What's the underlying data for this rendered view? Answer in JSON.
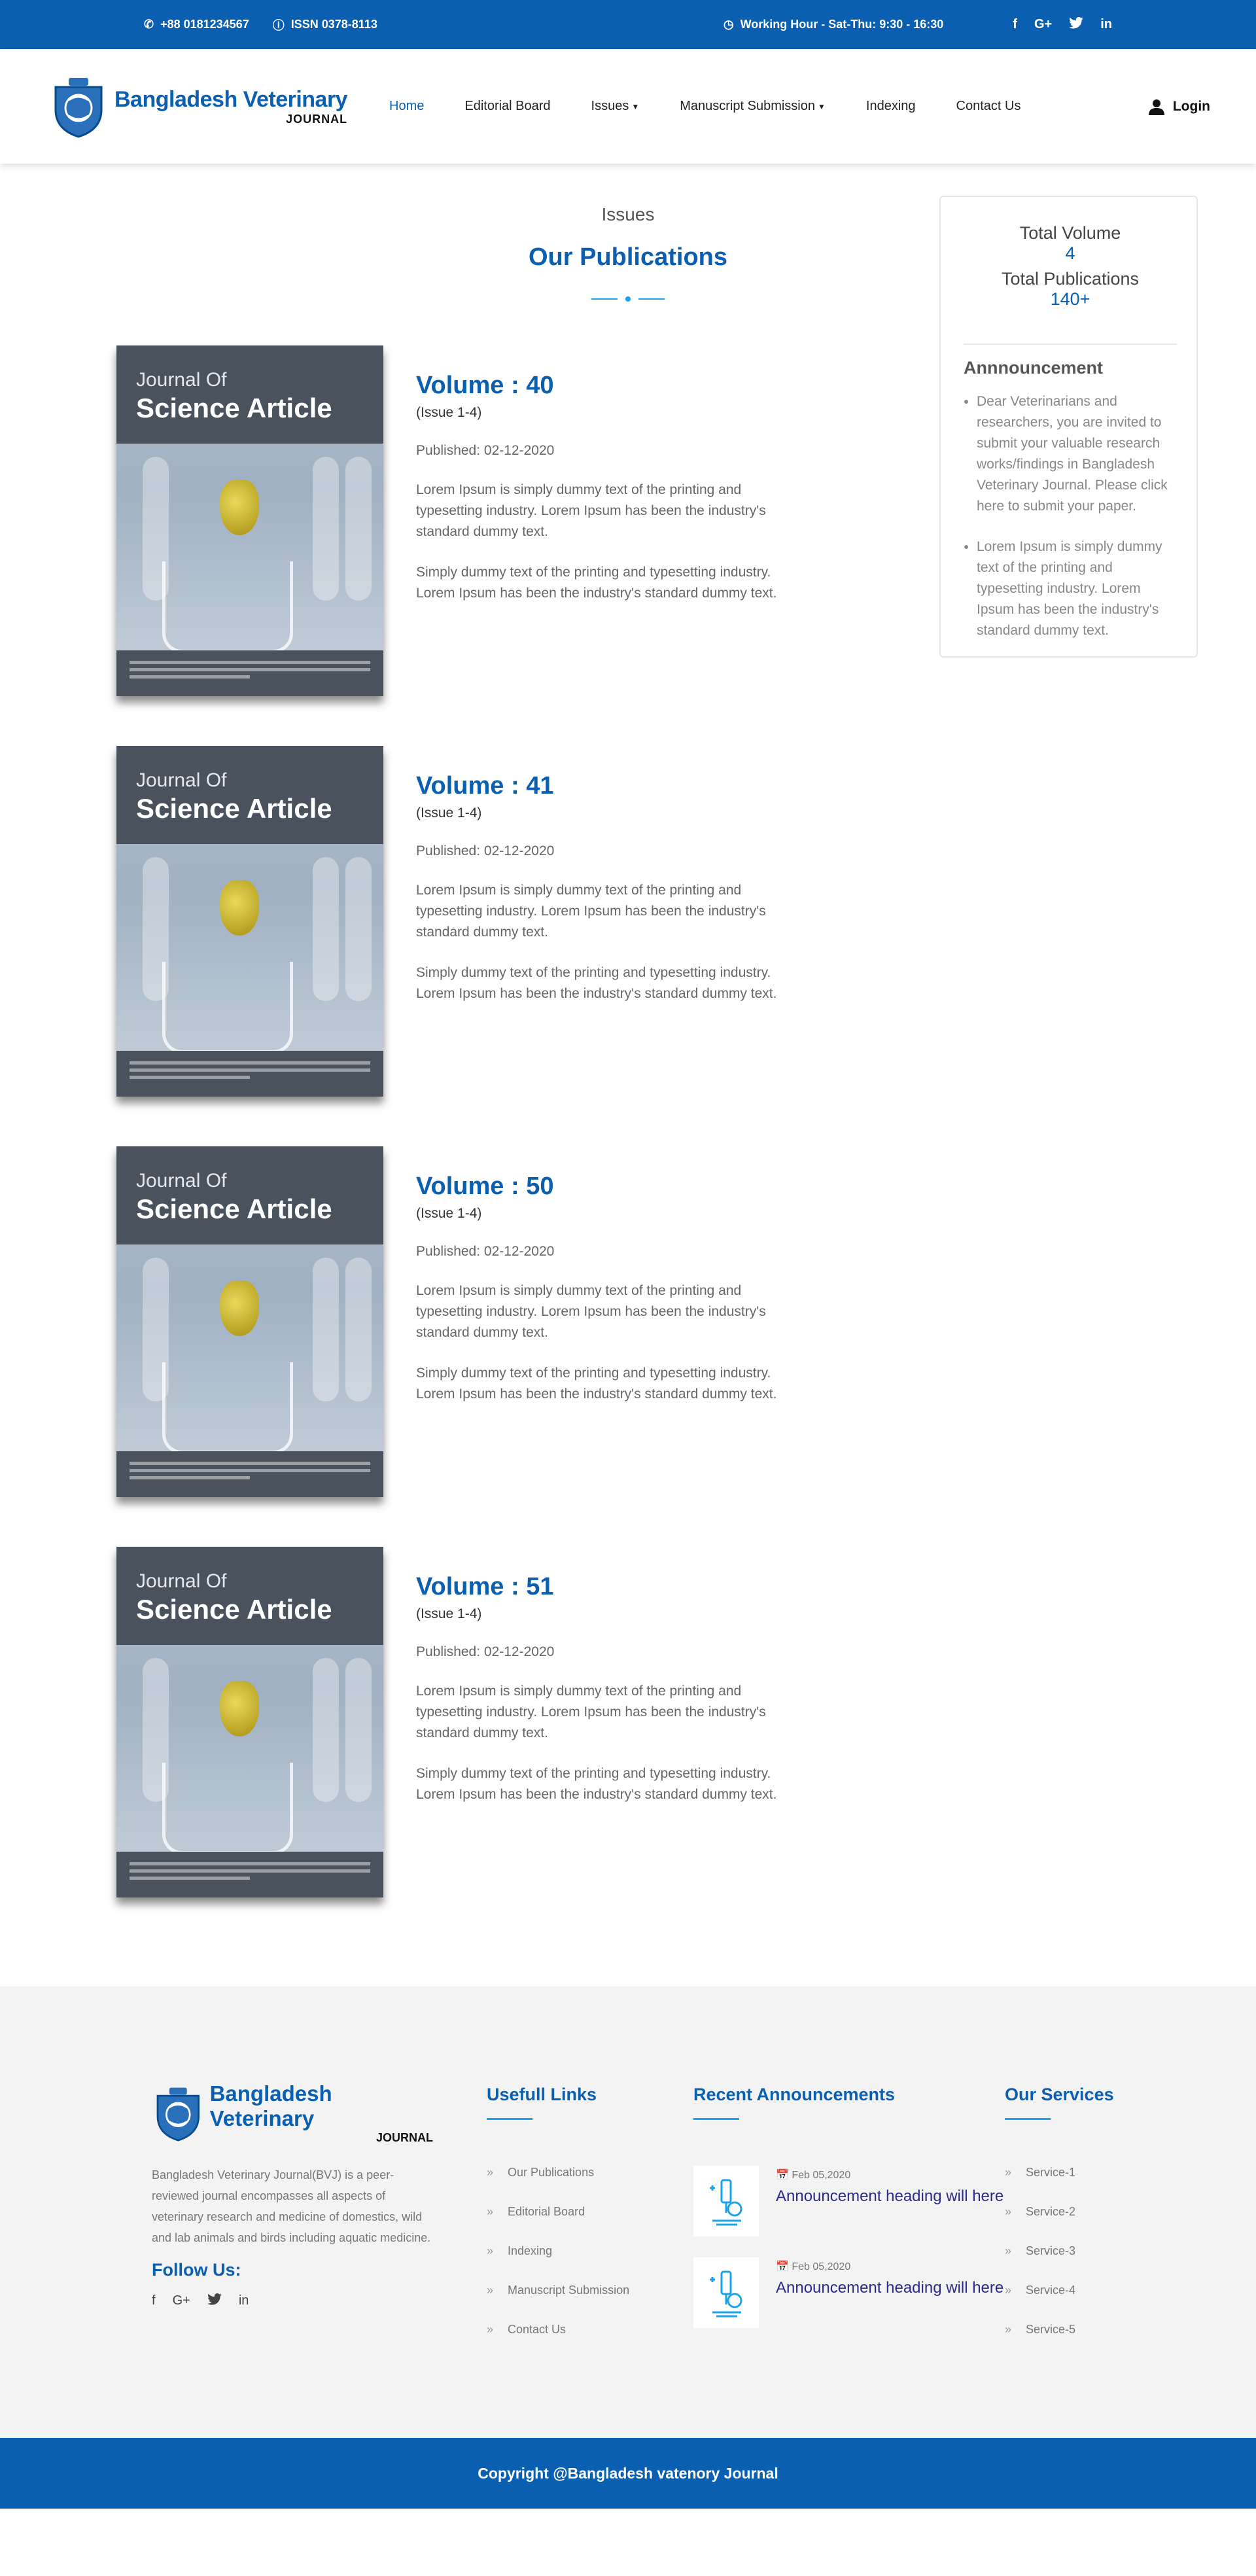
{
  "topbar": {
    "phone": "+88 0181234567",
    "issn": "ISSN 0378-8113",
    "hours": "Working Hour - Sat-Thu: 9:30 - 16:30",
    "social": [
      "f",
      "G+",
      "twitter",
      "in"
    ]
  },
  "header": {
    "brand_name": "Bangladesh Veterinary",
    "brand_sub": "JOURNAL",
    "nav": [
      {
        "label": "Home"
      },
      {
        "label": "Editorial Board"
      },
      {
        "label": "Issues"
      },
      {
        "label": "Manuscript Submission"
      },
      {
        "label": "Indexing"
      },
      {
        "label": "Contact Us"
      }
    ],
    "login": "Login"
  },
  "section": {
    "eyebrow": "Issues",
    "title": "Our Publications"
  },
  "cover": {
    "line1": "Journal Of",
    "line2": "Science Article"
  },
  "volumes": [
    {
      "title": "Volume : 40",
      "issue": "(Issue 1-4)",
      "published": "Published: 02-12-2020",
      "p1": "Lorem Ipsum is simply dummy text of the printing and typesetting industry. Lorem Ipsum has been the industry's standard dummy text.",
      "p2": "Simply dummy text of the printing and typesetting industry. Lorem Ipsum has been the industry's standard dummy text."
    },
    {
      "title": "Volume : 41",
      "issue": "(Issue 1-4)",
      "published": "Published: 02-12-2020",
      "p1": "Lorem Ipsum is simply dummy text of the printing and typesetting industry. Lorem Ipsum has been the industry's standard dummy text.",
      "p2": "Simply dummy text of the printing and typesetting industry. Lorem Ipsum has been the industry's standard dummy text."
    },
    {
      "title": "Volume : 50",
      "issue": "(Issue 1-4)",
      "published": "Published: 02-12-2020",
      "p1": "Lorem Ipsum is simply dummy text of the printing and typesetting industry. Lorem Ipsum has been the industry's standard dummy text.",
      "p2": "Simply dummy text of the printing and typesetting industry. Lorem Ipsum has been the industry's standard dummy text."
    },
    {
      "title": "Volume : 51",
      "issue": "(Issue 1-4)",
      "published": "Published: 02-12-2020",
      "p1": "Lorem Ipsum is simply dummy text of the printing and typesetting industry. Lorem Ipsum has been the industry's standard dummy text.",
      "p2": "Simply dummy text of the printing and typesetting industry. Lorem Ipsum has been the industry's standard dummy text."
    }
  ],
  "sidebar": {
    "total_volume_label": "Total Volume",
    "total_volume_value": "4",
    "total_pubs_label": "Total Publications",
    "total_pubs_value": "140+",
    "announcement_title": "Annnouncement",
    "announcements": [
      "Dear Veterinarians and researchers, you are invited to submit your valuable research works/findings in Bangladesh Veterinary Journal. Please click here to submit your paper.",
      "Lorem Ipsum is simply dummy text of the printing and typesetting industry. Lorem Ipsum has been the industry's standard dummy text."
    ]
  },
  "footer": {
    "brand_name": "Bangladesh Veterinary",
    "brand_sub": "JOURNAL",
    "description": "Bangladesh Veterinary Journal(BVJ) is a peer-reviewed journal encompasses all aspects of veterinary research and medicine of domestics, wild and lab animals and birds including aquatic medicine.",
    "follow_us": "Follow Us:",
    "links_title": "Usefull Links",
    "links": [
      "Our Publications",
      "Editorial Board",
      "Indexing",
      "Manuscript Submission",
      "Contact Us"
    ],
    "recent_title": "Recent Announcements",
    "recent": [
      {
        "date": "Feb 05,2020",
        "heading": "Announcement heading will here"
      },
      {
        "date": "Feb 05,2020",
        "heading": "Announcement heading will here"
      }
    ],
    "services_title": "Our Services",
    "services": [
      "Service-1",
      "Service-2",
      "Service-3",
      "Service-4",
      "Service-5"
    ],
    "copyright": "Copyright @Bangladesh vatenory Journal"
  },
  "colors": {
    "primary": "#0b5fb0",
    "accent": "#1aa3e8",
    "footer_bg": "#f3f3f3"
  }
}
